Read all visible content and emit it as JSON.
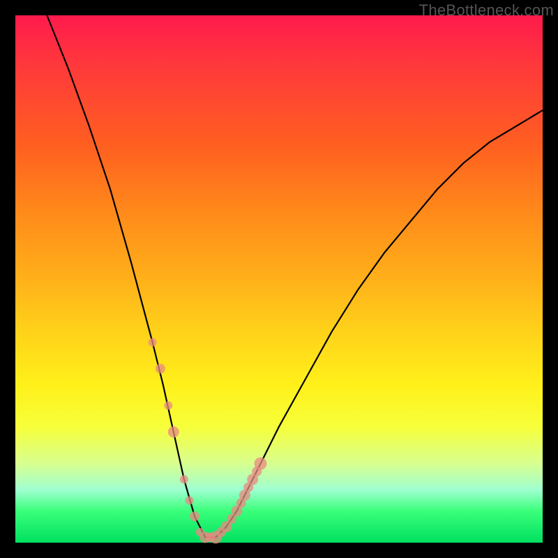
{
  "watermark": "TheBottleneck.com",
  "chart_data": {
    "type": "line",
    "title": "",
    "xlabel": "",
    "ylabel": "",
    "xlim": [
      0,
      100
    ],
    "ylim": [
      0,
      100
    ],
    "notes": "Background is a heat gradient: red (top) through orange/yellow to green (bottom). Black V-shaped curve descends from upper-left to a minimum near x≈35 then rises toward upper-right. Cluster of salmon-colored dots sits along curve near the minimum.",
    "series": [
      {
        "name": "bottleneck-curve",
        "x": [
          6,
          10,
          14,
          18,
          22,
          26,
          28,
          30,
          32,
          34,
          36,
          38,
          40,
          42,
          44,
          46,
          50,
          55,
          60,
          65,
          70,
          75,
          80,
          85,
          90,
          95,
          100
        ],
        "values": [
          100,
          90,
          79,
          67,
          53,
          38,
          30,
          21,
          12,
          5,
          1,
          1,
          3,
          6,
          10,
          14,
          22,
          31,
          40,
          48,
          55,
          61,
          67,
          72,
          76,
          79,
          82
        ]
      }
    ],
    "points": {
      "name": "data-points",
      "x": [
        26,
        27.5,
        29,
        30,
        32,
        33,
        34,
        35,
        36,
        37,
        38,
        39,
        40,
        41,
        42,
        42.8,
        43.5,
        44.2,
        45,
        45.8,
        46.5
      ],
      "values": [
        38,
        33,
        26,
        21,
        12,
        8,
        5,
        2,
        1,
        1,
        1,
        2,
        3,
        4.5,
        6,
        7.5,
        9,
        10.5,
        12,
        13.5,
        15
      ],
      "r": [
        6,
        7,
        6,
        8,
        6,
        6,
        7,
        6,
        8,
        7,
        9,
        7,
        8,
        7,
        8,
        7,
        8,
        7,
        8,
        7,
        9
      ]
    }
  }
}
